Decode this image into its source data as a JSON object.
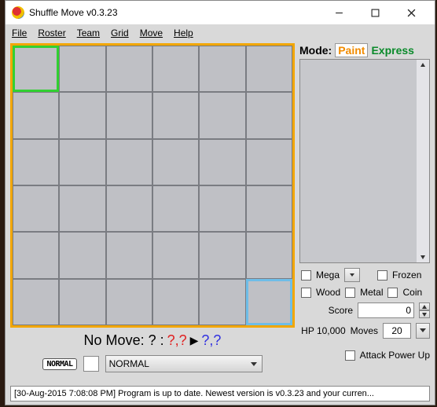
{
  "window": {
    "title": "Shuffle Move v0.3.23"
  },
  "menu": {
    "file": "File",
    "roster": "Roster",
    "team": "Team",
    "grid": "Grid",
    "move": "Move",
    "help": "Help"
  },
  "grid": {
    "rows": 6,
    "cols": 6,
    "green_cell": [
      0,
      0
    ],
    "blue_cell": [
      5,
      5
    ]
  },
  "nomove": {
    "prefix": "No Move: ? : ",
    "red": "?,?",
    "arrow": "▶",
    "blue": "?,?"
  },
  "type_row": {
    "badge": "NORMAL",
    "combo_value": "NORMAL"
  },
  "mode": {
    "label": "Mode:",
    "paint": "Paint",
    "express": "Express"
  },
  "checks": {
    "mega": "Mega",
    "frozen": "Frozen",
    "wood": "Wood",
    "metal": "Metal",
    "coin": "Coin"
  },
  "score": {
    "label": "Score",
    "value": "0"
  },
  "hp": {
    "label": "HP 10,000",
    "moves_label": "Moves",
    "moves_value": "20"
  },
  "apu": {
    "label": "Attack Power Up"
  },
  "status": "[30-Aug-2015 7:08:08 PM] Program is up to date. Newest version is v0.3.23 and your curren..."
}
